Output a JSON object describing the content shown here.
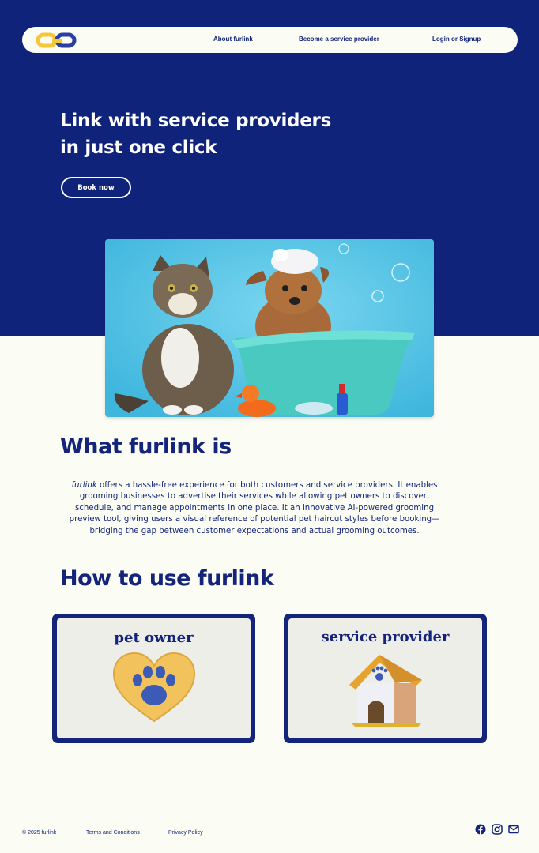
{
  "brand": {
    "logo_alt": "furlink-logo",
    "colors": {
      "primary": "#0f237a",
      "accent": "#f5c83b",
      "background": "#fbfcf3"
    }
  },
  "nav": {
    "links": [
      {
        "label": "About furlink"
      },
      {
        "label": "Become a service provider"
      },
      {
        "label": "Login or Signup"
      }
    ]
  },
  "hero": {
    "title_line1": "Link with service providers",
    "title_line2": "in just one click",
    "cta_label": "Book now",
    "image": "cat-and-dog-bath-photo"
  },
  "about": {
    "title": "What furlink is",
    "brand_word": "furlink",
    "body": " offers a hassle-free experience for both customers and service providers. It enables grooming businesses to advertise their services while allowing pet owners to discover, schedule, and manage appointments in one place. It an innovative AI-powered grooming preview tool, giving users a visual reference of potential pet haircut styles before booking—bridging the gap between customer expectations and actual grooming outcomes."
  },
  "how_to": {
    "title": "How to use furlink",
    "cards": [
      {
        "label": "pet owner",
        "icon": "paw-heart-icon"
      },
      {
        "label": "service provider",
        "icon": "dog-house-icon"
      }
    ]
  },
  "footer": {
    "copyright": "© 2025 furlink",
    "terms": "Terms and Conditions",
    "privacy": "Privacy Policy",
    "social_icons": [
      "facebook-icon",
      "instagram-icon",
      "mail-icon"
    ]
  }
}
